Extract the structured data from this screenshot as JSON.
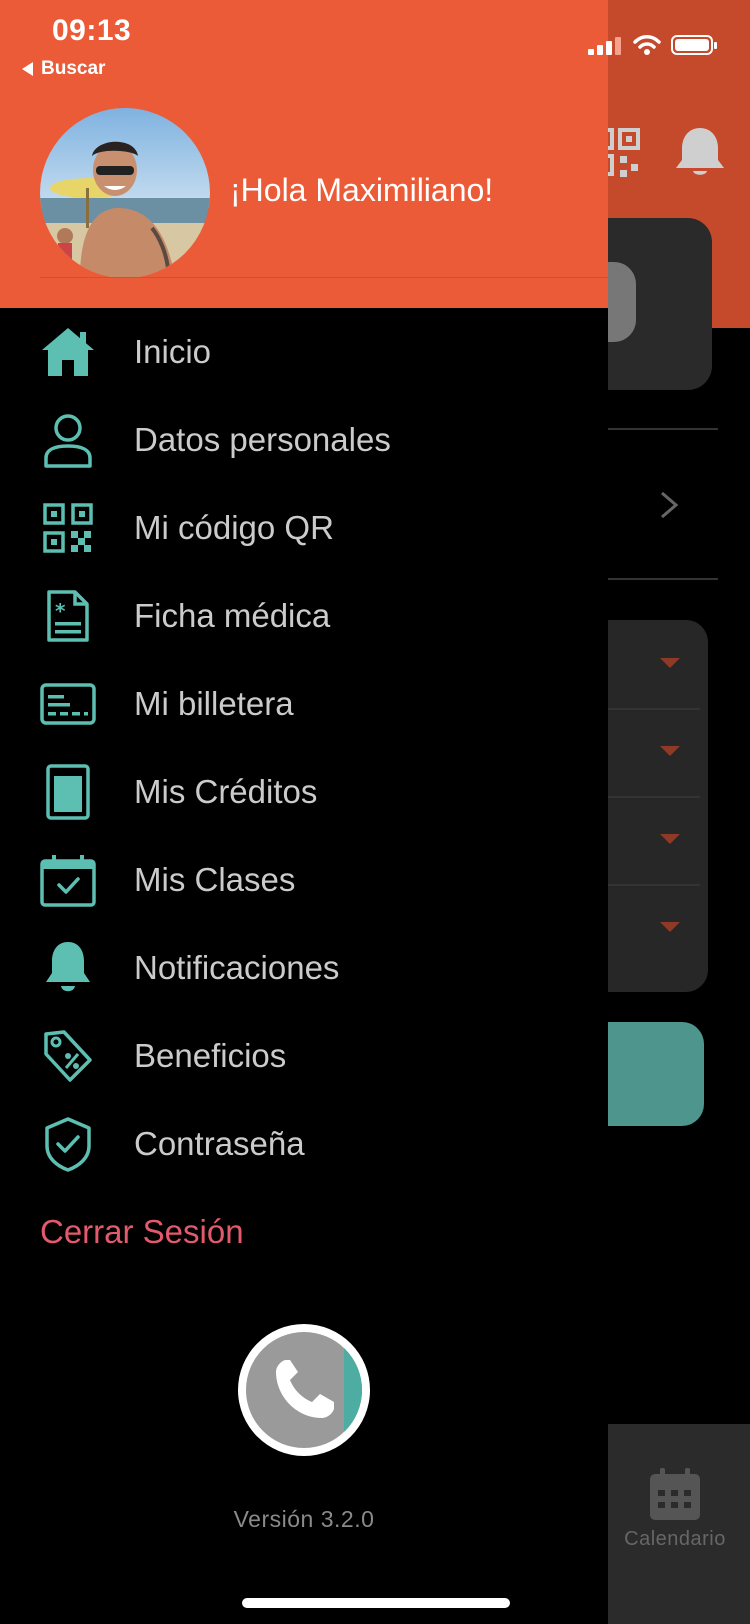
{
  "status_bar": {
    "time": "09:13",
    "back_label": "Buscar"
  },
  "drawer": {
    "greeting": "¡Hola Maximiliano!",
    "menu": [
      {
        "label": "Inicio",
        "icon": "home-icon"
      },
      {
        "label": "Datos personales",
        "icon": "user-icon"
      },
      {
        "label": "Mi código QR",
        "icon": "qr-code-icon"
      },
      {
        "label": "Ficha médica",
        "icon": "medical-file-icon"
      },
      {
        "label": "Mi billetera",
        "icon": "wallet-card-icon"
      },
      {
        "label": "Mis Créditos",
        "icon": "credits-icon"
      },
      {
        "label": "Mis Clases",
        "icon": "calendar-check-icon"
      },
      {
        "label": "Notificaciones",
        "icon": "bell-icon"
      },
      {
        "label": "Beneficios",
        "icon": "tag-icon"
      },
      {
        "label": "Contraseña",
        "icon": "shield-check-icon"
      }
    ],
    "logout_label": "Cerrar Sesión",
    "version": "Versión 3.2.0"
  },
  "background_app": {
    "tab_calendar_label": "Calendario"
  },
  "colors": {
    "header": "#ec5b37",
    "accent": "#5cbfb2",
    "logout": "#e35a6c",
    "menu_text": "#cbcbcb"
  }
}
